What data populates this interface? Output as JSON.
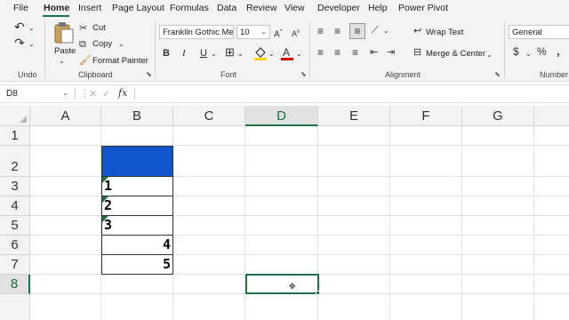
{
  "tabs": [
    "File",
    "Home",
    "Insert",
    "Page Layout",
    "Formulas",
    "Data",
    "Review",
    "View",
    "Developer",
    "Help",
    "Power Pivot"
  ],
  "active_tab": "Home",
  "ribbon": {
    "undo_group": "Undo",
    "clipboard": {
      "group": "Clipboard",
      "paste": "Paste",
      "cut": "Cut",
      "copy": "Copy",
      "format_painter": "Format Painter"
    },
    "font": {
      "group": "Font",
      "font_name": "Franklin Gothic Me",
      "font_size": "10",
      "bold": "B",
      "italic": "I",
      "underline": "U"
    },
    "alignment": {
      "group": "Alignment",
      "wrap_text": "Wrap Text",
      "merge_center": "Merge & Center"
    },
    "number": {
      "group": "Number",
      "format": "General",
      "currency": "$",
      "percent": "%"
    }
  },
  "formula_bar": {
    "name_box": "D8",
    "fx": "fx",
    "content": ""
  },
  "columns": [
    "A",
    "B",
    "C",
    "D",
    "E",
    "F",
    "G"
  ],
  "selected_column": "D",
  "rows": [
    "1",
    "2",
    "3",
    "4",
    "5",
    "6",
    "7",
    "8"
  ],
  "selected_row": "8",
  "cells": {
    "B3": "1",
    "B4": "2",
    "B5": "3",
    "B6": "4",
    "B7": "5"
  },
  "colors": {
    "accent": "#1e7145",
    "fill_b2": "#1155cc",
    "highlight": "#ffd700",
    "font_color": "#d00000"
  }
}
